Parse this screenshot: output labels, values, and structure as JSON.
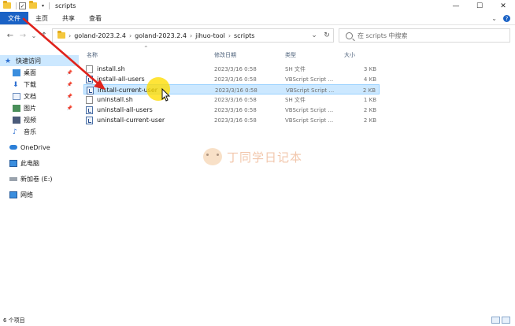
{
  "window": {
    "title": "scripts",
    "controls": {
      "minimize": "—",
      "maximize": "☐",
      "close": "✕"
    }
  },
  "quick_access_toolbar": {
    "dropdown": "▾"
  },
  "ribbon": {
    "tabs": [
      {
        "label": "文件"
      },
      {
        "label": "主页"
      },
      {
        "label": "共享"
      },
      {
        "label": "查看"
      }
    ],
    "expand": "⌄",
    "help": "?"
  },
  "address": {
    "back": "←",
    "forward": "→",
    "recent": "⌄",
    "up": "↑",
    "segments": [
      "goland-2023.2.4",
      "goland-2023.2.4",
      "jihuo-tool",
      "scripts"
    ],
    "separator": "›",
    "dropdown": "⌄",
    "refresh": "↻"
  },
  "search": {
    "placeholder": "在 scripts 中搜索"
  },
  "navigation": {
    "items": [
      {
        "label": "快速访问",
        "icon": "star-icon"
      },
      {
        "label": "桌面",
        "icon": "desktop-icon",
        "pinned": true
      },
      {
        "label": "下载",
        "icon": "download-icon",
        "pinned": true
      },
      {
        "label": "文档",
        "icon": "document-icon",
        "pinned": true
      },
      {
        "label": "图片",
        "icon": "picture-icon",
        "pinned": true
      },
      {
        "label": "视频",
        "icon": "video-icon"
      },
      {
        "label": "音乐",
        "icon": "music-icon"
      },
      {
        "label": "OneDrive",
        "icon": "cloud-icon"
      },
      {
        "label": "此电脑",
        "icon": "computer-icon"
      },
      {
        "label": "新加卷 (E:)",
        "icon": "drive-icon"
      },
      {
        "label": "网络",
        "icon": "network-icon"
      }
    ]
  },
  "file_list": {
    "columns": {
      "name": "名称",
      "date": "修改日期",
      "type": "类型",
      "size": "大小"
    },
    "rows": [
      {
        "name": "install.sh",
        "date": "2023/3/16 0:58",
        "type": "SH 文件",
        "size": "3 KB",
        "icon": "sh-file-icon"
      },
      {
        "name": "install-all-users",
        "date": "2023/3/16 0:58",
        "type": "VBScript Script ...",
        "size": "4 KB",
        "icon": "vbscript-file-icon"
      },
      {
        "name": "install-current-user",
        "date": "2023/3/16 0:58",
        "type": "VBScript Script ...",
        "size": "2 KB",
        "icon": "vbscript-file-icon",
        "selected": true
      },
      {
        "name": "uninstall.sh",
        "date": "2023/3/16 0:58",
        "type": "SH 文件",
        "size": "1 KB",
        "icon": "sh-file-icon"
      },
      {
        "name": "uninstall-all-users",
        "date": "2023/3/16 0:58",
        "type": "VBScript Script ...",
        "size": "2 KB",
        "icon": "vbscript-file-icon"
      },
      {
        "name": "uninstall-current-user",
        "date": "2023/3/16 0:58",
        "type": "VBScript Script ...",
        "size": "2 KB",
        "icon": "vbscript-file-icon"
      }
    ]
  },
  "status": {
    "item_count": "6 个项目"
  },
  "watermark": {
    "text": "丁同学日记本"
  },
  "colors": {
    "file_tab": "#1a62c5",
    "selection": "#cce8ff",
    "annotation_arrow": "#e0231c",
    "cursor_halo": "#ffdc00"
  }
}
